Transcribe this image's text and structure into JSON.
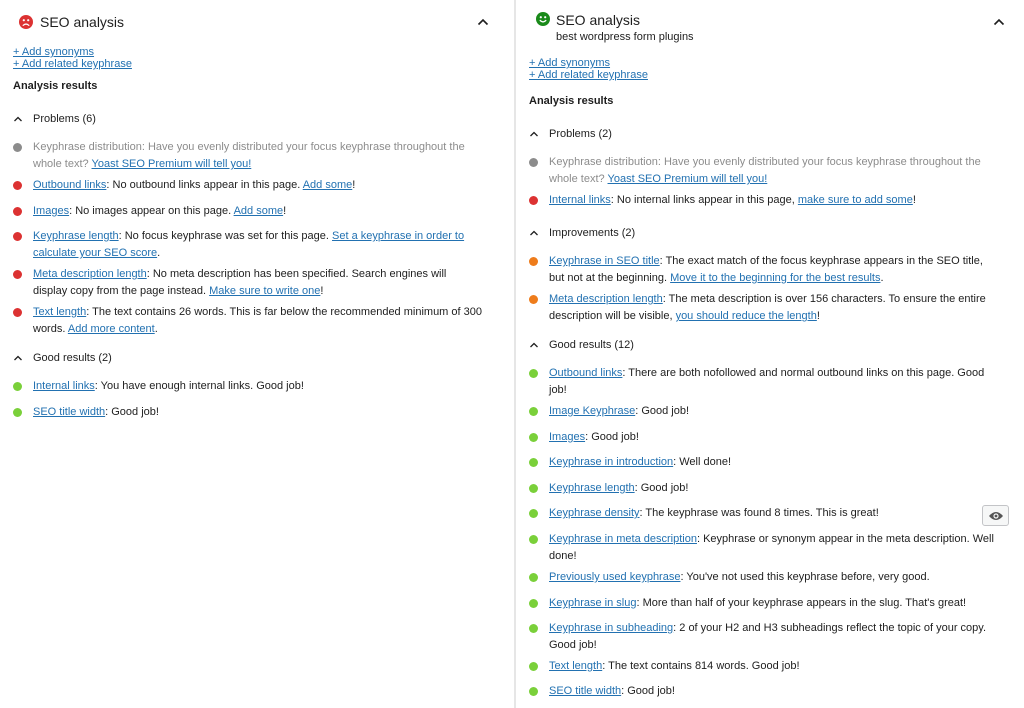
{
  "colors": {
    "red": "#dc3232",
    "orange": "#ee7c1b",
    "green": "#7ad03a",
    "gray": "#8c8c8c",
    "link": "#2271b1",
    "smiley_bad": "#dc3232",
    "smiley_good": "#1a8a1a"
  },
  "left": {
    "title": "SEO analysis",
    "status_icon": "sad-face-icon",
    "add_synonyms": "+ Add synonyms",
    "add_related": "+ Add related keyphrase",
    "analysis_results": "Analysis results",
    "problems": {
      "label": "Problems",
      "count": "(6)",
      "items": [
        {
          "color": "gray",
          "link": "",
          "text": "Keyphrase distribution: Have you evenly distributed your focus keyphrase throughout the whole text? ",
          "cta": "Yoast SEO Premium will tell you!",
          "end": ""
        },
        {
          "color": "red",
          "link": "Outbound links",
          "text": ": No outbound links appear in this page. ",
          "cta": "Add some",
          "end": "!"
        },
        {
          "color": "red",
          "link": "Images",
          "text": ": No images appear on this page. ",
          "cta": "Add some",
          "end": "!"
        },
        {
          "color": "red",
          "link": "Keyphrase length",
          "text": ": No focus keyphrase was set for this page. ",
          "cta": "Set a keyphrase in order to calculate your SEO score",
          "end": "."
        },
        {
          "color": "red",
          "link": "Meta description length",
          "text": ": No meta description has been specified. Search engines will display copy from the page instead. ",
          "cta": "Make sure to write one",
          "end": "!"
        },
        {
          "color": "red",
          "link": "Text length",
          "text": ": The text contains 26 words. This is far below the recommended minimum of 300 words. ",
          "cta": "Add more content",
          "end": "."
        }
      ]
    },
    "good": {
      "label": "Good results",
      "count": "(2)",
      "items": [
        {
          "color": "green",
          "link": "Internal links",
          "text": ": You have enough internal links. Good job!",
          "cta": "",
          "end": ""
        },
        {
          "color": "green",
          "link": "SEO title width",
          "text": ": Good job!",
          "cta": "",
          "end": ""
        }
      ]
    }
  },
  "right": {
    "title": "SEO analysis",
    "subtitle": "best wordpress form plugins",
    "status_icon": "happy-face-icon",
    "add_synonyms": "+ Add synonyms",
    "add_related": "+ Add related keyphrase",
    "analysis_results": "Analysis results",
    "problems": {
      "label": "Problems",
      "count": "(2)",
      "items": [
        {
          "color": "gray",
          "link": "",
          "text": "Keyphrase distribution: Have you evenly distributed your focus keyphrase throughout the whole text? ",
          "cta": "Yoast SEO Premium will tell you!",
          "end": ""
        },
        {
          "color": "red",
          "link": "Internal links",
          "text": ": No internal links appear in this page, ",
          "cta": "make sure to add some",
          "end": "!"
        }
      ]
    },
    "improvements": {
      "label": "Improvements",
      "count": "(2)",
      "items": [
        {
          "color": "orange",
          "link": "Keyphrase in SEO title",
          "text": ": The exact match of the focus keyphrase appears in the SEO title, but not at the beginning. ",
          "cta": "Move it to the beginning for the best results",
          "end": "."
        },
        {
          "color": "orange",
          "link": "Meta description length",
          "text": ": The meta description is over 156 characters. To ensure the entire description will be visible, ",
          "cta": "you should reduce the length",
          "end": "!"
        }
      ]
    },
    "good": {
      "label": "Good results",
      "count": "(12)",
      "items": [
        {
          "color": "green",
          "link": "Outbound links",
          "text": ": There are both nofollowed and normal outbound links on this page. Good job!",
          "cta": "",
          "end": ""
        },
        {
          "color": "green",
          "link": "Image Keyphrase",
          "text": ": Good job!",
          "cta": "",
          "end": ""
        },
        {
          "color": "green",
          "link": "Images",
          "text": ": Good job!",
          "cta": "",
          "end": ""
        },
        {
          "color": "green",
          "link": "Keyphrase in introduction",
          "text": ": Well done!",
          "cta": "",
          "end": ""
        },
        {
          "color": "green",
          "link": "Keyphrase length",
          "text": ": Good job!",
          "cta": "",
          "end": ""
        },
        {
          "color": "green",
          "link": "Keyphrase density",
          "text": ": The keyphrase was found 8 times. This is great!",
          "cta": "",
          "end": "",
          "eye": true
        },
        {
          "color": "green",
          "link": "Keyphrase in meta description",
          "text": ": Keyphrase or synonym appear in the meta description. Well done!",
          "cta": "",
          "end": ""
        },
        {
          "color": "green",
          "link": "Previously used keyphrase",
          "text": ": You've not used this keyphrase before, very good.",
          "cta": "",
          "end": ""
        },
        {
          "color": "green",
          "link": "Keyphrase in slug",
          "text": ": More than half of your keyphrase appears in the slug. That's great!",
          "cta": "",
          "end": ""
        },
        {
          "color": "green",
          "link": "Keyphrase in subheading",
          "text": ": 2 of your H2 and H3 subheadings reflect the topic of your copy. Good job!",
          "cta": "",
          "end": ""
        },
        {
          "color": "green",
          "link": "Text length",
          "text": ": The text contains 814 words. Good job!",
          "cta": "",
          "end": ""
        },
        {
          "color": "green",
          "link": "SEO title width",
          "text": ": Good job!",
          "cta": "",
          "end": ""
        }
      ]
    }
  }
}
